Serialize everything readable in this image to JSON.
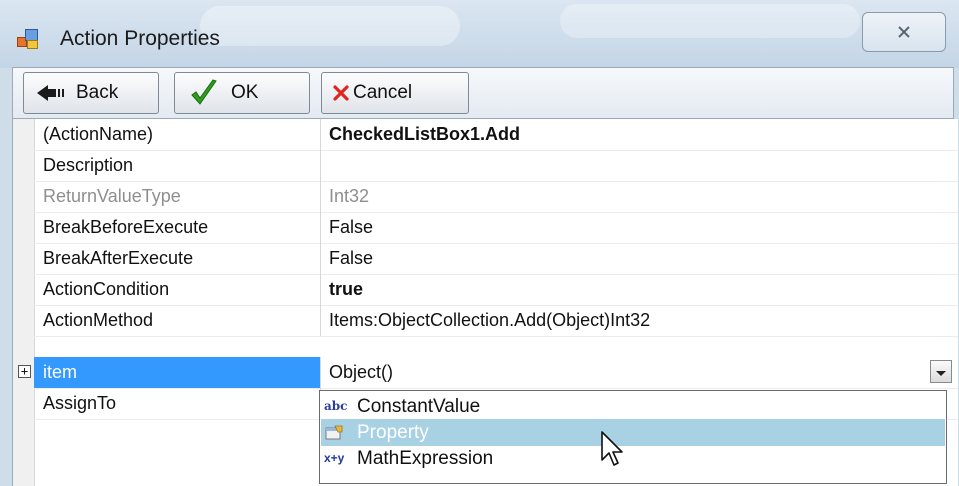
{
  "window": {
    "title": "Action Properties",
    "close_icon": "close-x-icon"
  },
  "toolbar": {
    "back_label": "Back",
    "ok_label": "OK",
    "cancel_label": "Cancel"
  },
  "grid": {
    "rows": [
      {
        "name": "(ActionName)",
        "value": "CheckedListBox1.Add",
        "bold": true
      },
      {
        "name": "Description",
        "value": ""
      },
      {
        "name": "ReturnValueType",
        "value": "Int32",
        "disabled": true
      },
      {
        "name": "BreakBeforeExecute",
        "value": "False"
      },
      {
        "name": "BreakAfterExecute",
        "value": "False"
      },
      {
        "name": "ActionCondition",
        "value": "true",
        "bold": true
      },
      {
        "name": "ActionMethod",
        "value": "Items:ObjectCollection.Add(Object)Int32"
      },
      {
        "name": "item",
        "value": "Object()",
        "selected": true,
        "expandable": true,
        "expand_glyph": "+"
      },
      {
        "name": "AssignTo",
        "value": ""
      }
    ]
  },
  "dropdown": {
    "items": [
      {
        "label": "ConstantValue",
        "icon": "abc-icon",
        "icon_text": "abc"
      },
      {
        "label": "Property",
        "icon": "property-icon",
        "highlighted": true
      },
      {
        "label": "MathExpression",
        "icon": "math-expression-icon",
        "icon_text": "x+y"
      }
    ]
  },
  "colors": {
    "selection": "#3399ff",
    "dropdown_hover": "#a8d2e4"
  }
}
